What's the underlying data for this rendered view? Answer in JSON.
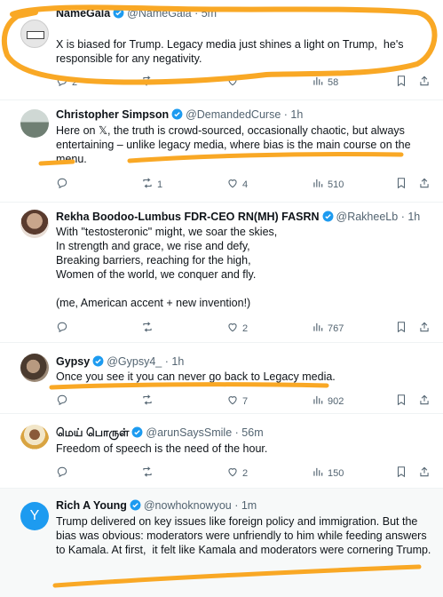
{
  "tweets": [
    {
      "name": "NameGala",
      "handle": "@NameGala",
      "time": "· 5m",
      "body": "X is biased for Trump. Legacy media just shines a light on Trump,  he's responsible for any negativity.",
      "replies": "2",
      "retweets": "",
      "likes": "",
      "views": "58",
      "avatar_color": "#e6e6e6"
    },
    {
      "name": "Christopher Simpson",
      "handle": "@DemandedCurse",
      "time": "· 1h",
      "body": "Here on 𝕏, the truth is crowd-sourced, occasionally chaotic, but always entertaining – unlike legacy media, where bias is the main course on the menu.",
      "replies": "",
      "retweets": "1",
      "likes": "4",
      "views": "510",
      "avatar_color": "#9aa7a0"
    },
    {
      "name": "Rekha Boodoo-Lumbus FDR-CEO RN(MH) FASRN",
      "handle": "@RakheeLb",
      "time": "· 1h",
      "body": "With \"testosteronic\" might, we soar the skies,\nIn strength and grace, we rise and defy,\nBreaking barriers, reaching for the high,\nWomen of the world, we conquer and fly.\n\n(me, American accent + new invention!)",
      "replies": "",
      "retweets": "",
      "likes": "2",
      "views": "767",
      "avatar_color": "#c9a58b"
    },
    {
      "name": "Gypsy",
      "handle": "@Gypsy4_",
      "time": "· 1h",
      "body": "Once you see it you can never go back to Legacy media.",
      "replies": "",
      "retweets": "",
      "likes": "7",
      "views": "902",
      "avatar_color": "#7d6f62"
    },
    {
      "name": "மெய் பொருள்",
      "handle": "@arunSaysSmile",
      "time": "· 56m",
      "body": "Freedom of speech is the need of the hour.",
      "replies": "",
      "retweets": "",
      "likes": "2",
      "views": "150",
      "avatar_color": "#d9c29a"
    },
    {
      "name": "Rich A Young",
      "handle": "@nowhoknowyou",
      "time": "· 1m",
      "body": "Trump delivered on key issues like foreign policy and immigration. But the bias was obvious: moderators were unfriendly to him while feeding answers to Kamala. At first,  it felt like Kamala and moderators were cornering Trump.",
      "replies": "",
      "retweets": "",
      "likes": "",
      "views": "",
      "avatar_letter": "Y",
      "avatar_color": "#1d9bf0"
    }
  ],
  "colors": {
    "verified": "#1d9bf0",
    "scribble": "#f9a825",
    "muted": "#536471"
  }
}
